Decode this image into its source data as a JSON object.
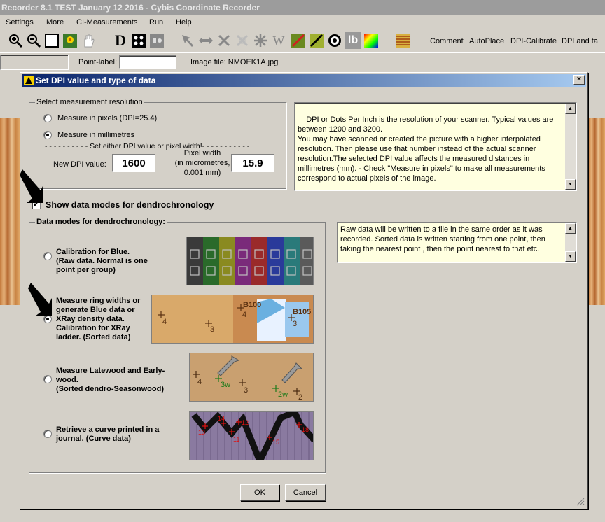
{
  "window": {
    "title": "Recorder 8.1 TEST January 12 2016 - Cybis Coordinate Recorder"
  },
  "menu": [
    "Settings",
    "More",
    "CI-Measurements",
    "Run",
    "Help"
  ],
  "toolbar": {
    "text_buttons": [
      "Comment",
      "AutoPlace",
      "DPI-Calibrate",
      "DPI and ta"
    ],
    "letter_d": "D",
    "letter_w": "W",
    "letter_lb": "lb"
  },
  "pointbar": {
    "point_label": "Point-label:",
    "point_value": "",
    "image_file_label": "Image file: NMOEK1A.jpg"
  },
  "dialog": {
    "title": "Set DPI value and type of data",
    "close": "×",
    "resolution": {
      "group_label": "Select measurement resolution",
      "option_pixels": "Measure in pixels (DPI=25.4)",
      "option_mm": "Measure in millimetres",
      "separator": "- - - - - - - - - - Set either DPI value or pixel width!- - - - - - - - - - -",
      "dpi_label": "New DPI value:",
      "dpi_value": "1600",
      "pixel_width_label_1": "Pixel width",
      "pixel_width_label_2": "(in micrometres,",
      "pixel_width_label_3": "0.001 mm)",
      "pixel_width_value": "15.9"
    },
    "dpi_info": "DPI or Dots Per Inch is the resolution of your scanner. Typical values are between 1200 and 3200.\nYou may have scanned or created the picture with a higher interpolated resolution. Then please use that number instead of the actual scanner resolution.The selected DPI value affects the measured distances in millimetres (mm). - Check \"Measure in pixels\" to make all measurements correspond to actual pixels of the image.",
    "show_modes_label": "Show data modes for dendrochronology",
    "show_modes_check": "✔",
    "modes": {
      "group_label": "Data modes for dendrochronology:",
      "mode1": "Calibration for Blue.\n(Raw data. Normal is one point per group)",
      "mode2": "Measure ring widths or generate Blue data or XRay density data. Calibration for XRay ladder. (Sorted data)",
      "mode3": "Measure Latewood and Early-wood.\n(Sorted dendro-Seasonwood)",
      "mode4": "Retrieve a curve printed in a journal. (Curve data)",
      "img2_labels": [
        "4",
        "3",
        "B100",
        "4",
        "B105",
        "3"
      ],
      "img3_labels": [
        "4",
        "3w",
        "3",
        "2w",
        "2"
      ],
      "img4_labels": [
        "13",
        "14",
        "12",
        "11",
        "15",
        "18"
      ]
    },
    "raw_info": "Raw data will be written to a file in the same order as it was recorded. Sorted data is written starting from one point, then taking the nearest point , then the point nearest to that etc.",
    "ok": "OK",
    "cancel": "Cancel"
  }
}
